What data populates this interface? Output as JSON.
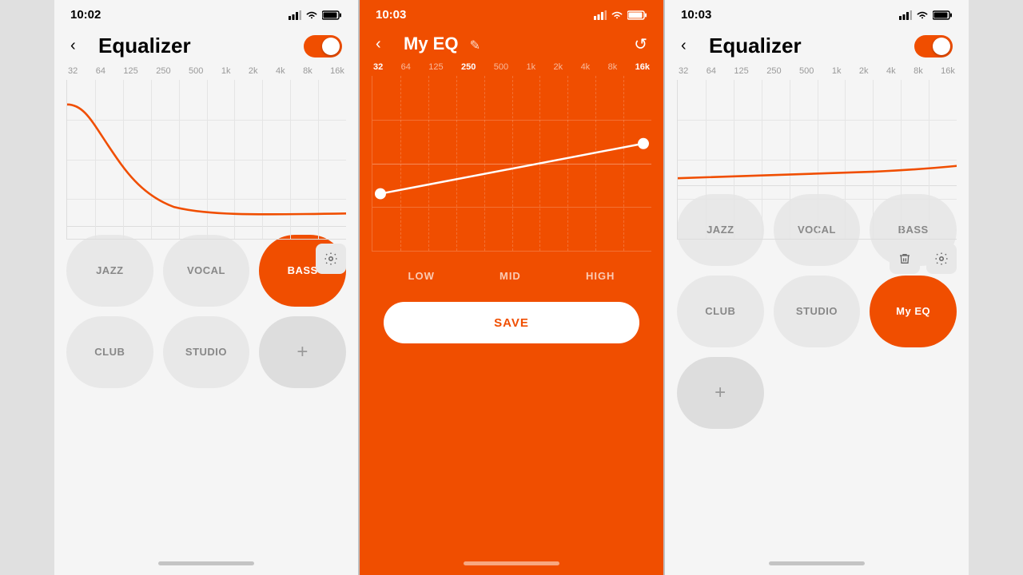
{
  "screen1": {
    "time": "10:02",
    "title": "Equalizer",
    "toggle_on": true,
    "freqs": [
      "32",
      "64",
      "125",
      "250",
      "500",
      "1k",
      "2k",
      "4k",
      "8k",
      "16k"
    ],
    "active_freq": null,
    "presets": [
      {
        "id": "jazz",
        "label": "JAZZ",
        "active": false
      },
      {
        "id": "vocal",
        "label": "VOCAL",
        "active": false
      },
      {
        "id": "bass",
        "label": "BASS",
        "active": true
      },
      {
        "id": "club",
        "label": "CLUB",
        "active": false
      },
      {
        "id": "studio",
        "label": "STUDIO",
        "active": false
      },
      {
        "id": "add",
        "label": "+",
        "active": false,
        "type": "add"
      }
    ],
    "gear_icon": "⚙"
  },
  "screen2": {
    "time": "10:03",
    "title": "My EQ",
    "freqs": [
      "32",
      "64",
      "125",
      "250",
      "500",
      "1k",
      "2k",
      "4k",
      "8k",
      "16k"
    ],
    "active_freqs": [
      "32",
      "250",
      "16k"
    ],
    "eq_labels": [
      "LOW",
      "MID",
      "HIGH"
    ],
    "save_label": "SAVE",
    "reset_icon": "↺",
    "edit_icon": "✎"
  },
  "screen3": {
    "time": "10:03",
    "title": "Equalizer",
    "toggle_on": true,
    "freqs": [
      "32",
      "64",
      "125",
      "250",
      "500",
      "1k",
      "2k",
      "4k",
      "8k",
      "16k"
    ],
    "active_freq": null,
    "presets": [
      {
        "id": "jazz",
        "label": "JAZZ",
        "active": false
      },
      {
        "id": "vocal",
        "label": "VOCAL",
        "active": false
      },
      {
        "id": "bass",
        "label": "BASS",
        "active": false
      },
      {
        "id": "club",
        "label": "CLUB",
        "active": false
      },
      {
        "id": "studio",
        "label": "STUDIO",
        "active": false
      },
      {
        "id": "myeq",
        "label": "My EQ",
        "active": true
      },
      {
        "id": "add",
        "label": "+",
        "active": false,
        "type": "add"
      }
    ],
    "trash_icon": "🗑",
    "gear_icon": "⚙"
  }
}
